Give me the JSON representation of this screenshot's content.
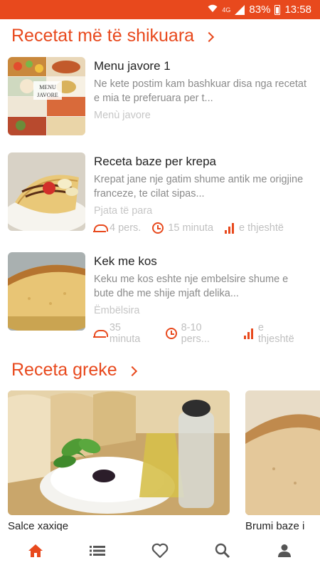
{
  "status_bar": {
    "wifi_icon": "wifi-icon",
    "network": "4G",
    "signal_icon": "signal-icon",
    "battery": "83%",
    "battery_icon": "battery-icon",
    "time": "13:58"
  },
  "most_viewed": {
    "title": "Recetat më të shikuara",
    "items": [
      {
        "title": "Menu javore 1",
        "desc": "Ne kete postim kam bashkuar disa nga recetat e mia te preferuara per t...",
        "category": "Menù javore",
        "thumb_caption": "MENU JAVORE 1",
        "meta": []
      },
      {
        "title": "Receta baze per krepa",
        "desc": "Krepat jane nje gatim shume antik me origjine franceze, te cilat sipas...",
        "category": "Pjata të para",
        "meta": [
          "4 pers.",
          "15 minuta",
          "e thjeshtë"
        ]
      },
      {
        "title": "Kek me kos",
        "desc": "Keku me kos eshte nje embelsire shume e bute dhe me shije mjaft delika...",
        "category": "Ëmbëlsira",
        "meta": [
          "35 minuta",
          "8-10 pers...",
          "e thjeshtë"
        ]
      }
    ]
  },
  "greek": {
    "title": "Receta greke",
    "cards": [
      {
        "label": "Salce xaxiqe"
      },
      {
        "label": "Brumi baze i"
      }
    ]
  },
  "nav": [
    {
      "icon": "home-icon",
      "active": true
    },
    {
      "icon": "list-icon",
      "active": false
    },
    {
      "icon": "heart-icon",
      "active": false
    },
    {
      "icon": "search-icon",
      "active": false
    },
    {
      "icon": "profile-icon",
      "active": false
    }
  ],
  "colors": {
    "accent": "#e8491d",
    "text": "#222222",
    "muted": "#8a8a8a",
    "inactive_nav": "#555555"
  }
}
